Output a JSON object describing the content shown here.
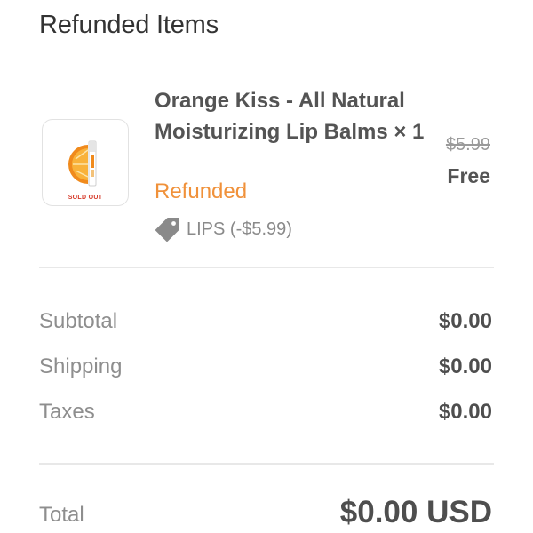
{
  "section": {
    "title": "Refunded Items"
  },
  "item": {
    "image_badge": "SOLD OUT",
    "name": "Orange Kiss - All Natural Moisturizing Lip Balms × 1",
    "status": "Refunded",
    "discount_code": "LIPS (-$5.99)",
    "original_price": "$5.99",
    "final_price": "Free",
    "tag_icon": "tag-icon",
    "image_icon": "orange-slice-lip-balm-image"
  },
  "summary": {
    "rows": [
      {
        "label": "Subtotal",
        "value": "$0.00"
      },
      {
        "label": "Shipping",
        "value": "$0.00"
      },
      {
        "label": "Taxes",
        "value": "$0.00"
      }
    ],
    "total_label": "Total",
    "total_value": "$0.00 USD"
  },
  "colors": {
    "status_refunded": "#f0913a",
    "text_primary": "#545454",
    "text_muted": "#8e8e8e",
    "sold_out": "#d63a2a"
  }
}
